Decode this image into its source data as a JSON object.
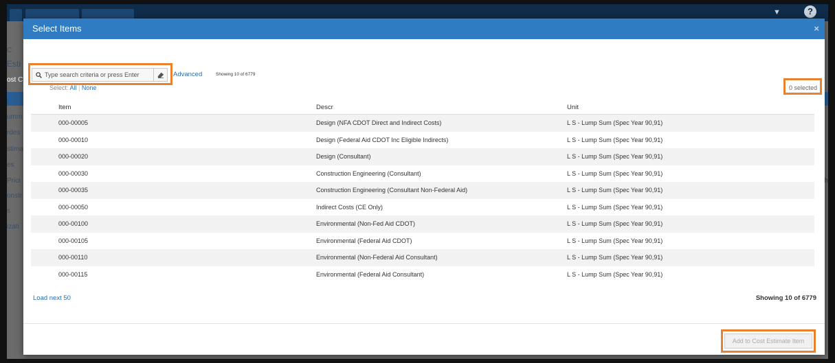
{
  "background": {
    "side_labels": [
      "C",
      "Esti",
      "ost C",
      "l",
      "umm",
      "rdes",
      "stima",
      "es",
      "Prici",
      "onstr",
      "s",
      "izati"
    ],
    "right_text": "0 ch"
  },
  "modal": {
    "title": "Select Items",
    "close_glyph": "×"
  },
  "search": {
    "placeholder": "Type search criteria or press Enter",
    "advanced_label": "Advanced",
    "showing_top": "Showing 10 of 6779"
  },
  "selection": {
    "prefix": "Select:",
    "all": "All",
    "none": "None",
    "selected_count": "0 selected"
  },
  "table": {
    "columns": [
      "Item",
      "Descr",
      "Unit"
    ],
    "rows": [
      {
        "item": "000-00005",
        "descr": "Design (NFA CDOT Direct and Indirect Costs)",
        "unit": "L S - Lump Sum  (Spec Year 90,91)"
      },
      {
        "item": "000-00010",
        "descr": "Design (Federal Aid CDOT Inc Eligible Indirects)",
        "unit": "L S - Lump Sum  (Spec Year 90,91)"
      },
      {
        "item": "000-00020",
        "descr": "Design (Consultant)",
        "unit": "L S - Lump Sum  (Spec Year 90,91)"
      },
      {
        "item": "000-00030",
        "descr": "Construction Engineering (Consultant)",
        "unit": "L S - Lump Sum  (Spec Year 90,91)"
      },
      {
        "item": "000-00035",
        "descr": "Construction Engineering (Consultant Non-Federal Aid)",
        "unit": "L S - Lump Sum  (Spec Year 90,91)"
      },
      {
        "item": "000-00050",
        "descr": "Indirect Costs (CE Only)",
        "unit": "L S - Lump Sum  (Spec Year 90,91)"
      },
      {
        "item": "000-00100",
        "descr": "Environmental (Non-Fed Aid CDOT)",
        "unit": "L S - Lump Sum  (Spec Year 90,91)"
      },
      {
        "item": "000-00105",
        "descr": "Environmental (Federal Aid CDOT)",
        "unit": "L S - Lump Sum  (Spec Year 90,91)"
      },
      {
        "item": "000-00110",
        "descr": "Environmental (Non-Federal Aid Consultant)",
        "unit": "L S - Lump Sum  (Spec Year 90,91)"
      },
      {
        "item": "000-00115",
        "descr": "Environmental (Federal Aid Consultant)",
        "unit": "L S - Lump Sum  (Spec Year 90,91)"
      }
    ]
  },
  "footer": {
    "load_next": "Load next 50",
    "showing_bottom": "Showing 10 of 6779",
    "add_button": "Add to Cost Estimate Item"
  },
  "colors": {
    "header": "#2f7cc2",
    "link": "#2a6db0",
    "highlight": "#e8822e"
  },
  "icons": [
    "search-icon",
    "eraser-icon",
    "close-icon",
    "help-icon",
    "caret-down-icon"
  ]
}
